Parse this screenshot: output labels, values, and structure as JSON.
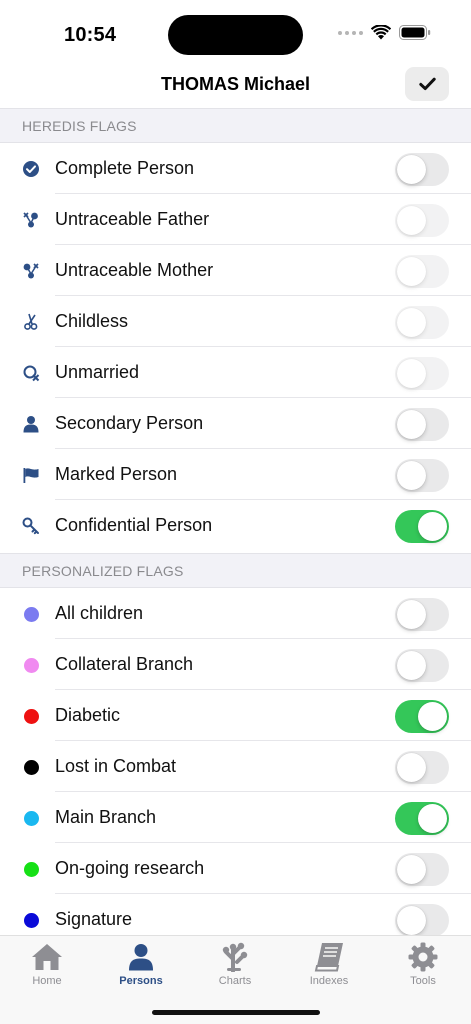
{
  "status": {
    "time": "10:54"
  },
  "nav": {
    "title": "THOMAS Michael",
    "done_icon": "checkmark-icon"
  },
  "sections": [
    {
      "header": "HEREDIS FLAGS",
      "items": [
        {
          "label": "Complete Person",
          "icon": "check-circle-icon",
          "on": false
        },
        {
          "label": "Untraceable Father",
          "icon": "untraceable-father-icon",
          "on": false
        },
        {
          "label": "Untraceable Mother",
          "icon": "untraceable-mother-icon",
          "on": false
        },
        {
          "label": "Childless",
          "icon": "scissors-icon",
          "on": false
        },
        {
          "label": "Unmarried",
          "icon": "unmarried-ring-icon",
          "on": false
        },
        {
          "label": "Secondary Person",
          "icon": "person-icon",
          "on": false
        },
        {
          "label": "Marked Person",
          "icon": "flag-icon",
          "on": false
        },
        {
          "label": "Confidential Person",
          "icon": "key-icon",
          "on": true
        }
      ]
    },
    {
      "header": "PERSONALIZED FLAGS",
      "items": [
        {
          "label": "All children",
          "color": "#7b7bf0",
          "on": false
        },
        {
          "label": "Collateral Branch",
          "color": "#f08af0",
          "on": false
        },
        {
          "label": "Diabetic",
          "color": "#ee1111",
          "on": true
        },
        {
          "label": "Lost in Combat",
          "color": "#000000",
          "on": false
        },
        {
          "label": "Main Branch",
          "color": "#1ab8f0",
          "on": true
        },
        {
          "label": "On-going research",
          "color": "#16e016",
          "on": false
        },
        {
          "label": "Signature",
          "color": "#0a0ad8",
          "on": false
        }
      ]
    }
  ],
  "tabs": [
    {
      "label": "Home",
      "icon": "home-icon",
      "active": false
    },
    {
      "label": "Persons",
      "icon": "person-icon",
      "active": true
    },
    {
      "label": "Charts",
      "icon": "tree-chart-icon",
      "active": false
    },
    {
      "label": "Indexes",
      "icon": "book-icon",
      "active": false
    },
    {
      "label": "Tools",
      "icon": "gear-icon",
      "active": false
    }
  ],
  "colors": {
    "accent": "#2d4f86",
    "toggle_on": "#34c759",
    "toggle_off": "#e9e9ea",
    "tab_inactive": "#8e8e93",
    "header_bg": "#f2f2f7"
  }
}
